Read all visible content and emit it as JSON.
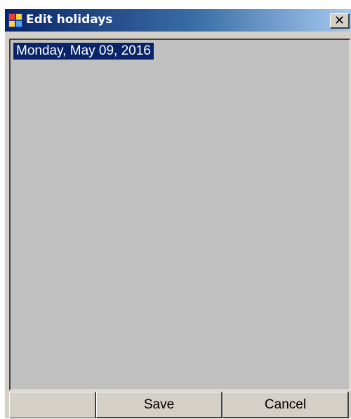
{
  "window": {
    "title": "Edit holidays",
    "close_glyph": "✕",
    "icon": "application-icon"
  },
  "holidays_list": {
    "items": [
      {
        "label": "Monday, May 09, 2016",
        "selected": true
      }
    ]
  },
  "buttons": {
    "save_label": "Save",
    "cancel_label": "Cancel"
  },
  "colors": {
    "titlebar_start": "#0a246a",
    "titlebar_end": "#a6caf0",
    "selection_bg": "#0a246a",
    "list_bg": "#c0c0c0",
    "face": "#d4d0c8"
  }
}
